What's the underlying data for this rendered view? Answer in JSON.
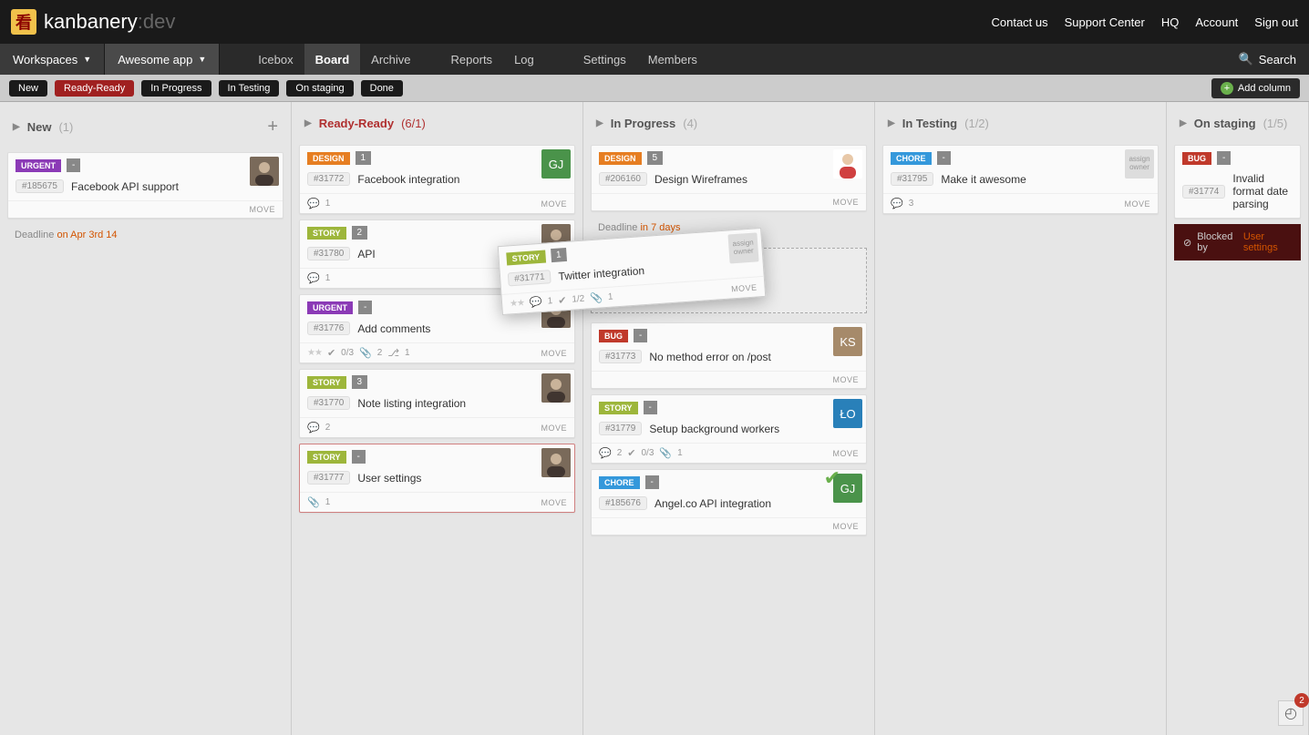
{
  "brand": {
    "name": "kanbanery",
    "suffix": ":dev",
    "logo_char": "看"
  },
  "top_nav": {
    "contact": "Contact us",
    "support": "Support Center",
    "hq": "HQ",
    "account": "Account",
    "signout": "Sign out"
  },
  "menus": {
    "workspaces": "Workspaces",
    "app": "Awesome app"
  },
  "tabs": {
    "icebox": "Icebox",
    "board": "Board",
    "archive": "Archive",
    "reports": "Reports",
    "log": "Log",
    "settings": "Settings",
    "members": "Members"
  },
  "search": "Search",
  "filters": [
    "New",
    "Ready-Ready",
    "In Progress",
    "In Testing",
    "On staging",
    "Done"
  ],
  "add_column": "Add column",
  "columns": [
    {
      "name": "New",
      "count": "(1)"
    },
    {
      "name": "Ready-Ready",
      "count": "(6/1)"
    },
    {
      "name": "In Progress",
      "count": "(4)"
    },
    {
      "name": "In Testing",
      "count": "(1/2)"
    },
    {
      "name": "On staging",
      "count": "(1/5)"
    }
  ],
  "cards": {
    "c1": {
      "type": "URGENT",
      "pts": "-",
      "ticket": "#185675",
      "title": "Facebook API support",
      "move": "MOVE",
      "deadline_prefix": "Deadline",
      "deadline": "on Apr 3rd 14"
    },
    "r1": {
      "type": "DESIGN",
      "pts": "1",
      "ticket": "#31772",
      "title": "Facebook integration",
      "comments": "1",
      "move": "MOVE",
      "avatar": "GJ"
    },
    "r2": {
      "type": "STORY",
      "pts": "2",
      "ticket": "#31780",
      "title": "API",
      "comments": "1",
      "move": "MOVE"
    },
    "r3": {
      "type": "URGENT",
      "pts": "-",
      "ticket": "#31776",
      "title": "Add comments",
      "subtasks": "0/3",
      "attach": "2",
      "fork": "1",
      "move": "MOVE"
    },
    "r4": {
      "type": "STORY",
      "pts": "3",
      "ticket": "#31770",
      "title": "Note listing integration",
      "comments": "2",
      "move": "MOVE"
    },
    "r5": {
      "type": "STORY",
      "pts": "-",
      "ticket": "#31777",
      "title": "User settings",
      "attach": "1",
      "move": "MOVE"
    },
    "p1": {
      "type": "DESIGN",
      "pts": "5",
      "ticket": "#206160",
      "title": "Design Wireframes",
      "move": "MOVE",
      "deadline_prefix": "Deadline",
      "deadline": "in 7 days"
    },
    "drag": {
      "type": "STORY",
      "pts": "1",
      "ticket": "#31771",
      "title": "Twitter integration",
      "comments": "1",
      "subtasks": "1/2",
      "attach": "1",
      "move": "MOVE",
      "owner": "assign owner"
    },
    "p3": {
      "type": "BUG",
      "pts": "-",
      "ticket": "#31773",
      "title": "No method error on /post",
      "move": "MOVE",
      "avatar": "KS"
    },
    "p4": {
      "type": "STORY",
      "pts": "-",
      "ticket": "#31779",
      "title": "Setup background workers",
      "comments": "2",
      "subtasks": "0/3",
      "attach": "1",
      "move": "MOVE",
      "avatar": "ŁO"
    },
    "p5": {
      "type": "CHORE",
      "pts": "-",
      "ticket": "#185676",
      "title": "Angel.co API integration",
      "move": "MOVE",
      "avatar": "GJ"
    },
    "t1": {
      "type": "CHORE",
      "pts": "-",
      "ticket": "#31795",
      "title": "Make it awesome",
      "comments": "3",
      "move": "MOVE",
      "owner": "assign owner"
    },
    "s1": {
      "type": "BUG",
      "pts": "-",
      "ticket": "#31774",
      "title": "Invalid format date parsing"
    }
  },
  "blocked": {
    "label": "Blocked by",
    "link": "User settings"
  },
  "corner_count": "2"
}
